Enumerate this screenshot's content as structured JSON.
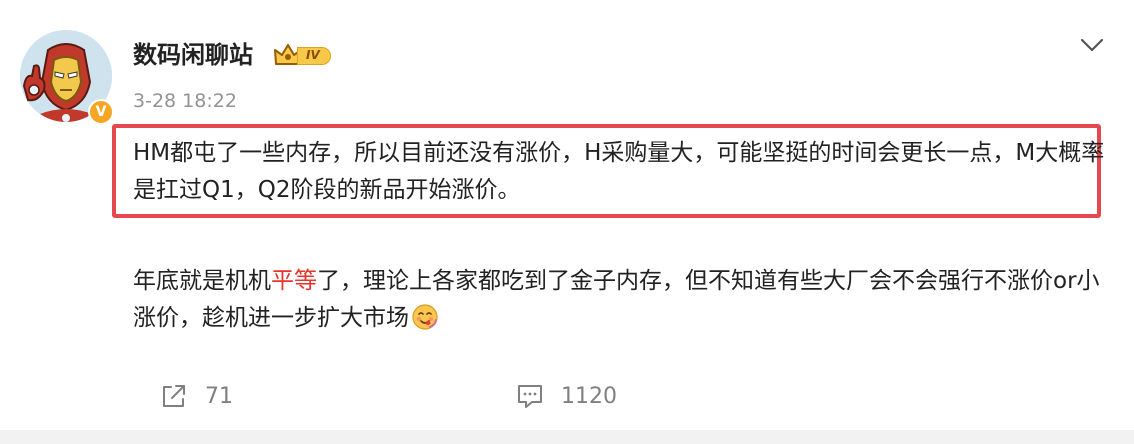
{
  "post": {
    "author": {
      "name": "数码闲聊站",
      "level": "IV",
      "verified_mark": "V",
      "avatar_icon": "iron-man-avatar-icon"
    },
    "timestamp": "3-28 18:22",
    "highlight_color": "#e5484d",
    "paragraph1": {
      "text": "HM都屯了一些内存，所以目前还没有涨价，H采购量大，可能坚挺的时间会更长一点，M大概率是扛过Q1，Q2阶段的新品开始涨价。"
    },
    "paragraph2": {
      "before": "年底就是机机",
      "red_text": "平等",
      "after": "了，理论上各家都吃到了金子内存，但不知道有些大厂会不会强行不涨价or小涨价，趁机进一步扩大市场",
      "emoji": "yummy-face-emoji-icon"
    },
    "actions": {
      "share_count": "71",
      "comment_count": "1120"
    }
  }
}
